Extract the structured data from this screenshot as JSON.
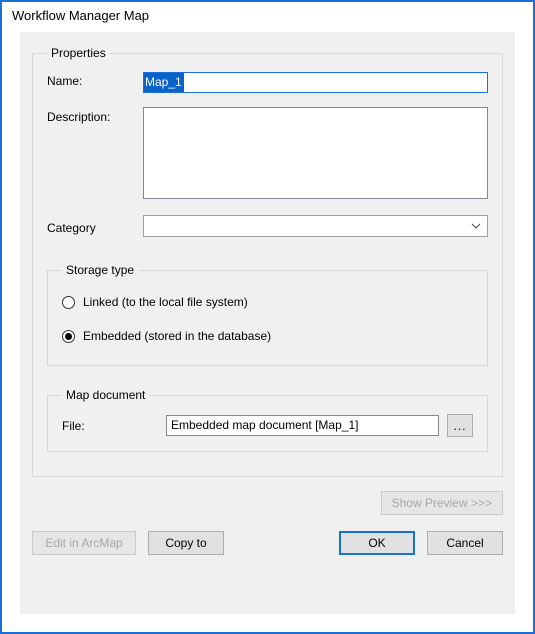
{
  "window": {
    "title": "Workflow Manager Map"
  },
  "properties": {
    "legend": "Properties",
    "name_label": "Name:",
    "name_value": "Map_1",
    "description_label": "Description:",
    "description_value": "",
    "category_label": "Category",
    "category_value": ""
  },
  "storage": {
    "legend": "Storage type",
    "linked_label": "Linked (to the local file system)",
    "embedded_label": "Embedded (stored in the database)",
    "selected": "embedded"
  },
  "mapdoc": {
    "legend": "Map document",
    "file_label": "File:",
    "file_value": "Embedded map document [Map_1]",
    "browse_label": "..."
  },
  "buttons": {
    "show_preview": "Show Preview >>>",
    "edit_arcmap": "Edit in ArcMap",
    "copy_to": "Copy to",
    "ok": "OK",
    "cancel": "Cancel"
  }
}
